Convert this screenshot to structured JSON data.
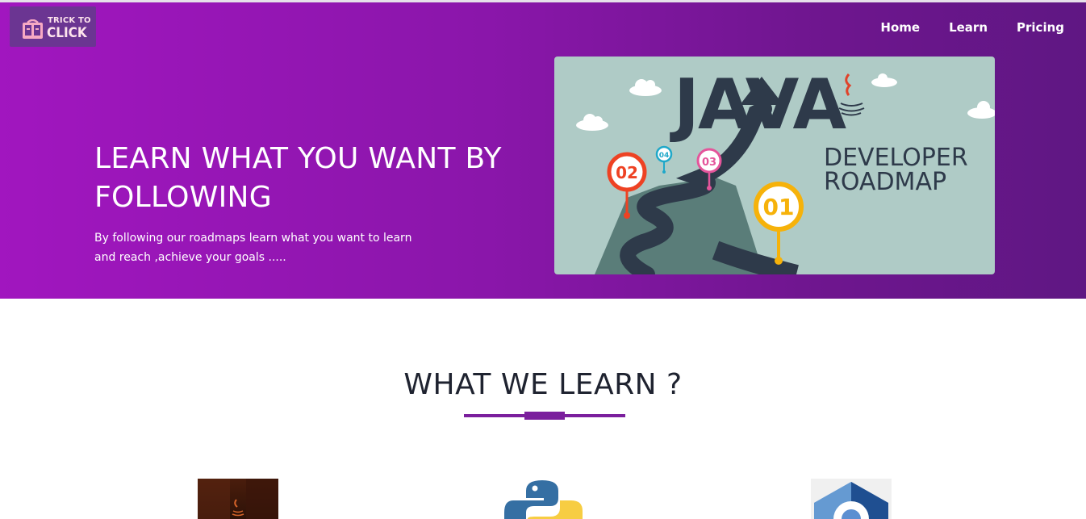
{
  "logo": {
    "line1": "TRICK TO",
    "line2": "CLICK"
  },
  "nav": {
    "items": [
      "Home",
      "Learn",
      "Pricing"
    ]
  },
  "hero": {
    "title": "LEARN WHAT YOU WANT BY FOLLOWING",
    "subtitle": "By following our roadmaps learn what you want to learn and reach ,achieve your goals .....",
    "image": {
      "headline": "JAVA",
      "line1": "DEVELOPER",
      "line2": "ROADMAP",
      "markers": [
        "01",
        "02",
        "03",
        "04"
      ]
    }
  },
  "section": {
    "title": "WHAT WE LEARN ?"
  },
  "courses": [
    {
      "icon": "java-icon"
    },
    {
      "icon": "python-icon"
    },
    {
      "icon": "c-language-icon"
    }
  ],
  "colors": {
    "hero_gradient_start": "#a116bf",
    "hero_gradient_end": "#5f1783",
    "accent": "#7b1f9d",
    "roadmap_bg": "#afcbc6",
    "marker_01": "#f6b20a",
    "marker_02": "#ee4223",
    "marker_03": "#e4559b",
    "marker_04": "#1fa8c9"
  }
}
